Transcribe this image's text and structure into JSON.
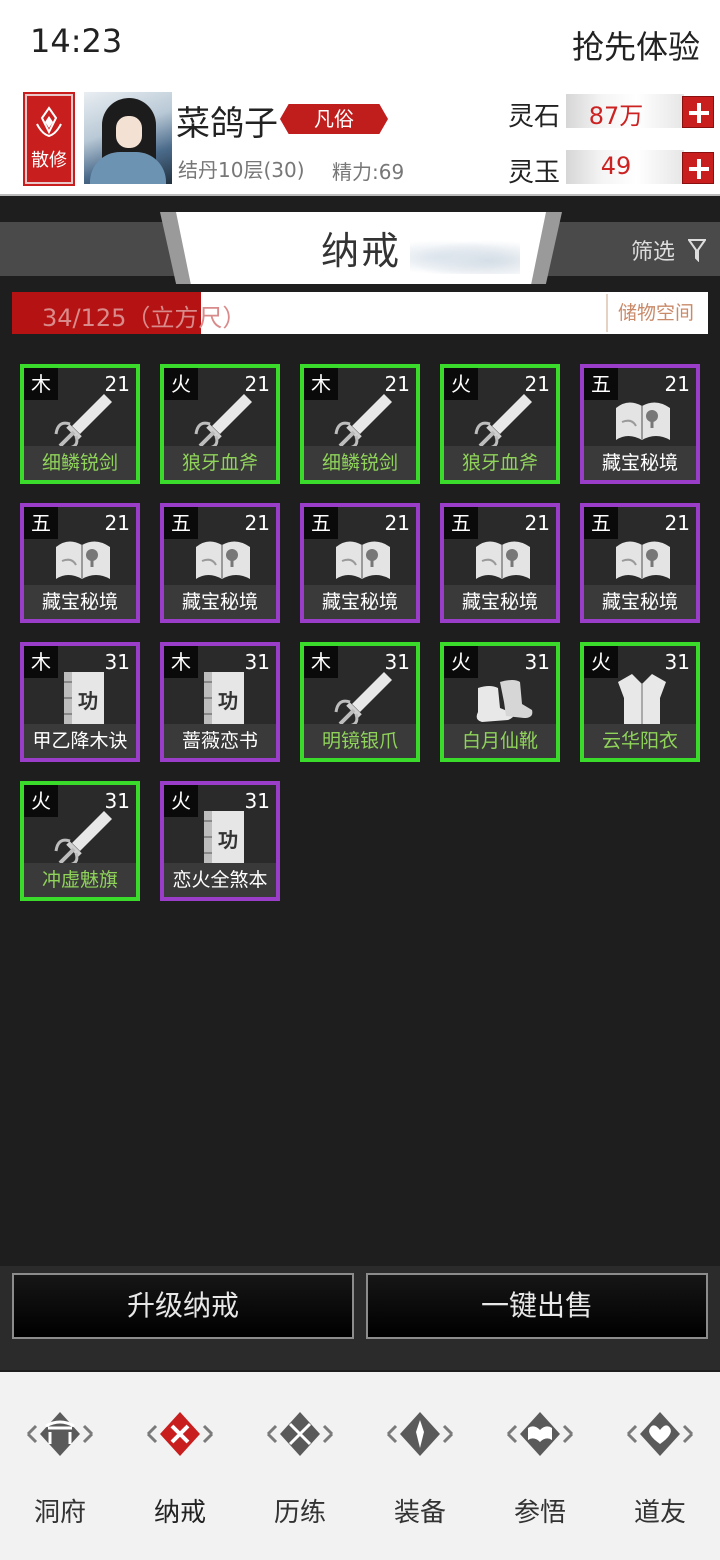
{
  "status_bar": {
    "time": "14:23",
    "cta": "抢先体验"
  },
  "player": {
    "sect": "散修",
    "name": "菜鸽子",
    "rank": "凡俗",
    "realm": "结丹10层(30)",
    "energy": "精力:69"
  },
  "currencies": [
    {
      "label": "灵石",
      "value": "87万"
    },
    {
      "label": "灵玉",
      "value": "49"
    }
  ],
  "page": {
    "title": "纳戒",
    "filter_label": "筛选",
    "capacity_text": "34/125（立方尺）",
    "capacity_ratio": 0.272,
    "storage_label": "储物空间"
  },
  "items": [
    {
      "element": "木",
      "level": "21",
      "name": "细鳞锐剑",
      "quality": "green",
      "icon": "sword-icon"
    },
    {
      "element": "火",
      "level": "21",
      "name": "狼牙血斧",
      "quality": "green",
      "icon": "sword-icon"
    },
    {
      "element": "木",
      "level": "21",
      "name": "细鳞锐剑",
      "quality": "green",
      "icon": "sword-icon"
    },
    {
      "element": "火",
      "level": "21",
      "name": "狼牙血斧",
      "quality": "green",
      "icon": "sword-icon"
    },
    {
      "element": "五",
      "level": "21",
      "name": "藏宝秘境",
      "quality": "purple",
      "icon": "map-scroll-icon"
    },
    {
      "element": "五",
      "level": "21",
      "name": "藏宝秘境",
      "quality": "purple",
      "icon": "map-scroll-icon"
    },
    {
      "element": "五",
      "level": "21",
      "name": "藏宝秘境",
      "quality": "purple",
      "icon": "map-scroll-icon"
    },
    {
      "element": "五",
      "level": "21",
      "name": "藏宝秘境",
      "quality": "purple",
      "icon": "map-scroll-icon"
    },
    {
      "element": "五",
      "level": "21",
      "name": "藏宝秘境",
      "quality": "purple",
      "icon": "map-scroll-icon"
    },
    {
      "element": "五",
      "level": "21",
      "name": "藏宝秘境",
      "quality": "purple",
      "icon": "map-scroll-icon"
    },
    {
      "element": "木",
      "level": "31",
      "name": "甲乙降木诀",
      "quality": "purple",
      "icon": "technique-book-icon"
    },
    {
      "element": "木",
      "level": "31",
      "name": "蔷薇恋书",
      "quality": "purple",
      "icon": "technique-book-icon"
    },
    {
      "element": "木",
      "level": "31",
      "name": "明镜银爪",
      "quality": "green",
      "icon": "sword-icon"
    },
    {
      "element": "火",
      "level": "31",
      "name": "白月仙靴",
      "quality": "green",
      "icon": "boots-icon"
    },
    {
      "element": "火",
      "level": "31",
      "name": "云华阳衣",
      "quality": "green",
      "icon": "robe-icon"
    },
    {
      "element": "火",
      "level": "31",
      "name": "冲虚魅旗",
      "quality": "green",
      "icon": "sword-icon"
    },
    {
      "element": "火",
      "level": "31",
      "name": "恋火全煞本",
      "quality": "purple",
      "icon": "technique-book-icon"
    }
  ],
  "book_glyph": "功",
  "actions": {
    "upgrade": "升级纳戒",
    "sell_all": "一键出售"
  },
  "nav": [
    {
      "label": "洞府",
      "icon": "cave-gate-icon"
    },
    {
      "label": "纳戒",
      "icon": "ring-close-icon",
      "active": true
    },
    {
      "label": "历练",
      "icon": "crossed-swords-icon"
    },
    {
      "label": "装备",
      "icon": "equipment-icon"
    },
    {
      "label": "参悟",
      "icon": "book-icon"
    },
    {
      "label": "道友",
      "icon": "friends-heart-icon"
    }
  ],
  "colors": {
    "green_border": "#3adb2a",
    "purple_border": "#9a3ec9",
    "green_name": "#8fd35a",
    "accent_red": "#c81e1e"
  }
}
